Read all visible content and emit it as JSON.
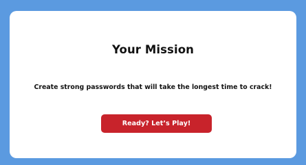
{
  "mission": {
    "title": "Your Mission",
    "description": "Create strong passwords that will take the longest time to crack!",
    "play_button_label": "Ready? Let’s Play!"
  },
  "colors": {
    "background": "#5b9ae0",
    "card": "#ffffff",
    "button": "#c8232b"
  }
}
